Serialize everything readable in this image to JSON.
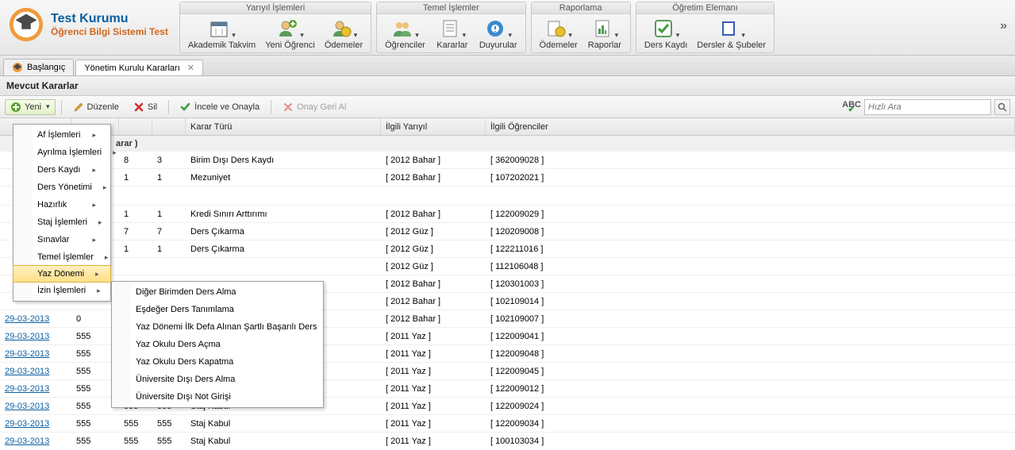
{
  "app": {
    "title": "Test Kurumu",
    "subtitle": "Öğrenci Bilgi Sistemi Test"
  },
  "ribbon": {
    "groups": [
      {
        "title": "Yarıyıl İşlemleri",
        "items": [
          {
            "label": "Akademik Takvim",
            "icon": "calendar"
          },
          {
            "label": "Yeni Öğrenci",
            "icon": "student-add"
          },
          {
            "label": "Ödemeler",
            "icon": "payments"
          }
        ]
      },
      {
        "title": "Temel İşlemler",
        "items": [
          {
            "label": "Öğrenciler",
            "icon": "students"
          },
          {
            "label": "Kararlar",
            "icon": "decisions"
          },
          {
            "label": "Duyurular",
            "icon": "announce"
          }
        ]
      },
      {
        "title": "Raporlama",
        "items": [
          {
            "label": "Ödemeler",
            "icon": "report-pay"
          },
          {
            "label": "Raporlar",
            "icon": "reports"
          }
        ]
      },
      {
        "title": "Öğretim Elemanı",
        "items": [
          {
            "label": "Ders Kaydı",
            "icon": "check"
          },
          {
            "label": "Dersler & Şubeler",
            "icon": "book"
          }
        ]
      }
    ]
  },
  "tabs": [
    {
      "label": "Başlangıç",
      "closable": false,
      "active": false
    },
    {
      "label": "Yönetim Kurulu Kararları",
      "closable": true,
      "active": true
    }
  ],
  "panel_title": "Mevcut Kararlar",
  "toolbar": {
    "new": "Yeni",
    "edit": "Düzenle",
    "delete": "Sil",
    "review": "İncele ve Onayla",
    "revert": "Onay Geri Al",
    "search_placeholder": "Hızlı Ara"
  },
  "new_menu": {
    "items": [
      "Af İşlemleri",
      "Ayrılma İşlemleri",
      "Ders Kaydı",
      "Ders Yönetimi",
      "Hazırlık",
      "Staj İşlemleri",
      "Sınavlar",
      "Temel İşlemler",
      "Yaz Dönemi",
      "İzin İşlemleri"
    ],
    "hovered_index": 8,
    "submenu": [
      "Diğer Birimden Ders Alma",
      "Eşdeğer Ders Tanımlama",
      "Yaz Dönemi İlk Defa Alınan Şartlı Başarılı Ders",
      "Yaz Okulu Ders Açma",
      "Yaz Okulu Ders Kapatma",
      "Üniversite Dışı Ders Alma",
      "Üniversite Dışı Not Girişi"
    ]
  },
  "grid": {
    "columns": {
      "date": "",
      "no": "",
      "kno": "",
      "adet": "",
      "tur": "Karar Türü",
      "yariyil": "İlgili Yarıyıl",
      "ogr": "İlgili Öğrenciler"
    },
    "group_label": "arar )",
    "rows": [
      {
        "date": "",
        "no": "",
        "kno": "8",
        "adet": "3",
        "tur": "Birim Dışı Ders Kaydı",
        "yariyil": "[ 2012 Bahar ]",
        "ogr": "[ 362009028 ]"
      },
      {
        "date": "",
        "no": "",
        "kno": "1",
        "adet": "1",
        "tur": "Mezuniyet",
        "yariyil": "[ 2012 Bahar ]",
        "ogr": "[ 107202021 ]"
      },
      {
        "blank": true
      },
      {
        "date": "",
        "no": "",
        "kno": "1",
        "adet": "1",
        "tur": "Kredi Sınırı Arttırımı",
        "yariyil": "[ 2012 Bahar ]",
        "ogr": "[ 122009029 ]"
      },
      {
        "date": "",
        "no": "",
        "kno": "7",
        "adet": "7",
        "tur": "Ders Çıkarma",
        "yariyil": "[ 2012 Güz ]",
        "ogr": "[ 120209008 ]"
      },
      {
        "date": "",
        "no": "",
        "kno": "1",
        "adet": "1",
        "tur": "Ders Çıkarma",
        "yariyil": "[ 2012 Güz ]",
        "ogr": "[ 122211016 ]"
      },
      {
        "date": "",
        "no": "",
        "kno": "",
        "adet": "",
        "tur": "",
        "yariyil": "[ 2012 Güz ]",
        "ogr": "[ 112106048 ]"
      },
      {
        "date": "",
        "no": "",
        "kno": "",
        "adet": "",
        "tur": "",
        "yariyil": "[ 2012 Bahar ]",
        "ogr": "[ 120301003 ]"
      },
      {
        "date": "",
        "no": "",
        "kno": "",
        "adet": "",
        "tur": "",
        "yariyil": "[ 2012 Bahar ]",
        "ogr": "[ 102109014 ]"
      },
      {
        "date": "29-03-2013",
        "is_date_link": true,
        "no": "0",
        "kno": "",
        "adet": "",
        "tur": "",
        "yariyil": "[ 2012 Bahar ]",
        "ogr": "[ 102109007 ]"
      },
      {
        "date": "29-03-2013",
        "is_date_link": true,
        "no": "555",
        "kno": "",
        "adet": "",
        "tur": "",
        "yariyil": "[ 2011 Yaz ]",
        "ogr": "[ 122009041 ]"
      },
      {
        "date": "29-03-2013",
        "is_date_link": true,
        "no": "555",
        "kno": "",
        "adet": "",
        "tur": "",
        "yariyil": "[ 2011 Yaz ]",
        "ogr": "[ 122009048 ]"
      },
      {
        "date": "29-03-2013",
        "is_date_link": true,
        "no": "555",
        "kno": "",
        "adet": "",
        "tur": "",
        "yariyil": "[ 2011 Yaz ]",
        "ogr": "[ 122009045 ]"
      },
      {
        "date": "29-03-2013",
        "is_date_link": true,
        "no": "555",
        "kno": "",
        "adet": "",
        "tur": "",
        "yariyil": "[ 2011 Yaz ]",
        "ogr": "[ 122009012 ]"
      },
      {
        "date": "29-03-2013",
        "is_date_link": true,
        "no": "555",
        "kno": "555",
        "adet": "555",
        "tur": "Staj Kabul",
        "yariyil": "[ 2011 Yaz ]",
        "ogr": "[ 122009024 ]"
      },
      {
        "date": "29-03-2013",
        "is_date_link": true,
        "no": "555",
        "kno": "555",
        "adet": "555",
        "tur": "Staj Kabul",
        "yariyil": "[ 2011 Yaz ]",
        "ogr": "[ 122009034 ]"
      },
      {
        "date": "29-03-2013",
        "is_date_link": true,
        "no": "555",
        "kno": "555",
        "adet": "555",
        "tur": "Staj Kabul",
        "yariyil": "[ 2011 Yaz ]",
        "ogr": "[ 100103034 ]"
      }
    ]
  }
}
